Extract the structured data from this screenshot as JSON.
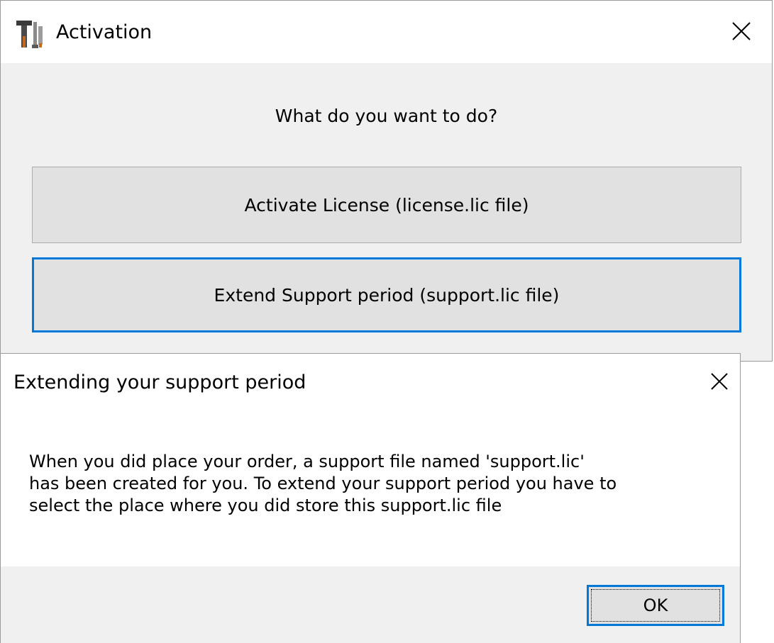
{
  "activation_window": {
    "title": "Activation",
    "app_icon": "tools-app-icon",
    "close_icon": "close-icon",
    "question": "What do you want to do?",
    "buttons": {
      "activate_license": "Activate License (license.lic file)",
      "extend_support": "Extend Support period (support.lic file)"
    }
  },
  "message_box": {
    "title": "Extending your support period",
    "close_icon": "close-icon",
    "body": "When you did place your order, a support file named 'support.lic'\nhas been created for you. To extend your support period you have to\nselect the place where you did store this support.lic file",
    "ok_label": "OK"
  },
  "colors": {
    "focus_border": "#0078d7",
    "button_face": "#e1e1e1",
    "window_face": "#f0f0f0"
  }
}
